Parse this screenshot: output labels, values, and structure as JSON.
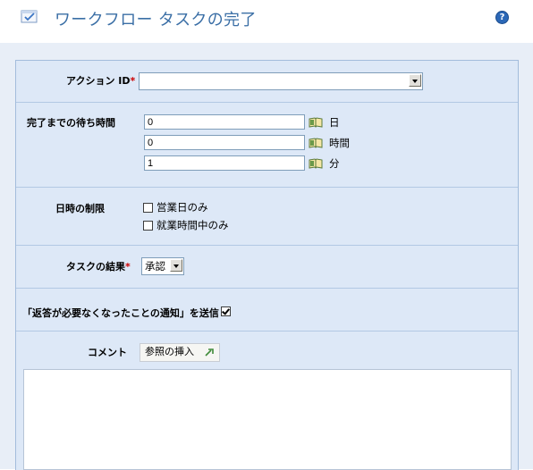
{
  "title": "ワークフロー タスクの完了",
  "help_glyph": "?",
  "action_id": {
    "label": "アクション ID",
    "required_mark": "*",
    "value": ""
  },
  "wait": {
    "label": "完了までの待ち時間",
    "rows": [
      {
        "value": "0",
        "unit": "日"
      },
      {
        "value": "0",
        "unit": "時間"
      },
      {
        "value": "1",
        "unit": "分"
      }
    ]
  },
  "time_limit": {
    "label": "日時の制限",
    "options": [
      {
        "label": "営業日のみ",
        "checked": false
      },
      {
        "label": "就業時間中のみ",
        "checked": false
      }
    ]
  },
  "task_result": {
    "label": "タスクの結果",
    "required_mark": "*",
    "value": "承認"
  },
  "notify": {
    "label": "「返答が必要なくなったことの通知」を送信",
    "checked": true
  },
  "comment": {
    "label": "コメント",
    "insert_ref_label": "参照の挿入",
    "value": ""
  },
  "colors": {
    "accent": "#3b6fa6",
    "panel": "#dde8f7",
    "border": "#a3bcdc"
  },
  "icons": [
    "task-check-icon",
    "help-icon",
    "book-icon",
    "insert-reference-icon"
  ]
}
